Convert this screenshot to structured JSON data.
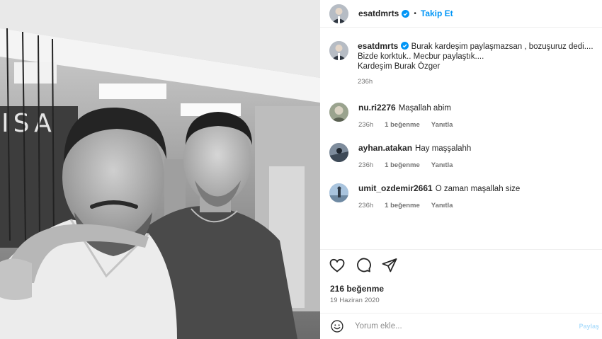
{
  "post": {
    "author": "esatdmrts",
    "follow_label": "Takip Et",
    "separator": "•",
    "verified_icon": "verified-badge-icon",
    "accent": "#0095f6"
  },
  "caption": {
    "username": "esatdmrts",
    "lines": [
      "Burak kardeşim paylaşmazsan , bozuşuruz dedi....",
      "Bizde korktuk.. Mecbur paylaştık....",
      "Kardeşim Burak Özger"
    ],
    "time": "236h"
  },
  "comments": [
    {
      "username": "nu.ri2276",
      "text": "Maşallah abim",
      "time": "236h",
      "likes": "1 beğenme",
      "reply": "Yanıtla"
    },
    {
      "username": "ayhan.atakan",
      "text": "Hay maşşalahh",
      "time": "236h",
      "likes": "1 beğenme",
      "reply": "Yanıtla"
    },
    {
      "username": "umit_ozdemir2661",
      "text": "O zaman maşallah size",
      "time": "236h",
      "likes": "1 beğenme",
      "reply": "Yanıtla"
    }
  ],
  "actions": {
    "like_icon": "heart-icon",
    "comment_icon": "comment-icon",
    "share_icon": "share-icon"
  },
  "stats": {
    "likes": "216 beğenme",
    "date": "19 Haziran 2020"
  },
  "composer": {
    "placeholder": "Yorum ekle...",
    "post_label": "Paylaş"
  }
}
